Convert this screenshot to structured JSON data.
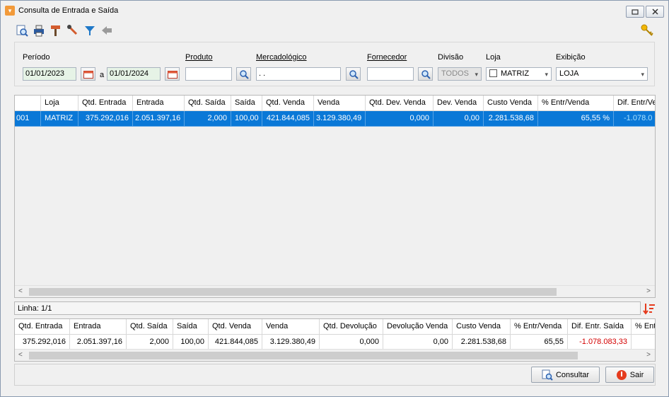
{
  "window": {
    "title": "Consulta de Entrada e Saída"
  },
  "toolbar": {
    "icons": [
      "zoom-search-icon",
      "print-icon",
      "hammer-icon",
      "wrench-icon",
      "filter-icon",
      "back-arrow-icon"
    ],
    "right_icon": "key-icon"
  },
  "filters": {
    "periodo_label": "Período",
    "date_from": "01/01/2023",
    "date_sep": "a",
    "date_to": "01/01/2024",
    "produto_label": "Produto",
    "produto_value": "",
    "mercadologico_label": "Mercadológico",
    "mercadologico_value": ".  .",
    "fornecedor_label": "Fornecedor",
    "fornecedor_value": "",
    "divisao_label": "Divisão",
    "divisao_value": "TODOS",
    "loja_label": "Loja",
    "loja_value": "MATRIZ",
    "exibicao_label": "Exibição",
    "exibicao_value": "LOJA"
  },
  "grid": {
    "columns": [
      "",
      "Loja",
      "Qtd. Entrada",
      "Entrada",
      "Qtd. Saída",
      "Saída",
      "Qtd. Venda",
      "Venda",
      "Qtd. Dev. Venda",
      "Dev. Venda",
      "Custo Venda",
      "% Entr/Venda",
      "Dif. Entr/Ve"
    ],
    "rows": [
      [
        "001",
        "MATRIZ",
        "375.292,016",
        "2.051.397,16",
        "2,000",
        "100,00",
        "421.844,085",
        "3.129.380,49",
        "0,000",
        "0,00",
        "2.281.538,68",
        "65,55 %",
        "-1.078.0"
      ]
    ]
  },
  "status": {
    "linha": "Linha: 1/1"
  },
  "totals": {
    "columns": [
      "Qtd. Entrada",
      "Entrada",
      "Qtd. Saída",
      "Saída",
      "Qtd. Venda",
      "Venda",
      "Qtd. Devolução",
      "Devolução Venda",
      "Custo Venda",
      "% Entr/Venda",
      "Dif. Entr. Saída",
      "% Ent"
    ],
    "values": [
      "375.292,016",
      "2.051.397,16",
      "2,000",
      "100,00",
      "421.844,085",
      "3.129.380,49",
      "0,000",
      "0,00",
      "2.281.538,68",
      "65,55",
      "-1.078.083,33",
      ""
    ]
  },
  "buttons": {
    "consultar": "Consultar",
    "sair": "Sair"
  },
  "colors": {
    "selection": "#0a78d7",
    "negative": "#d40000",
    "accent_red": "#e53b1d"
  }
}
